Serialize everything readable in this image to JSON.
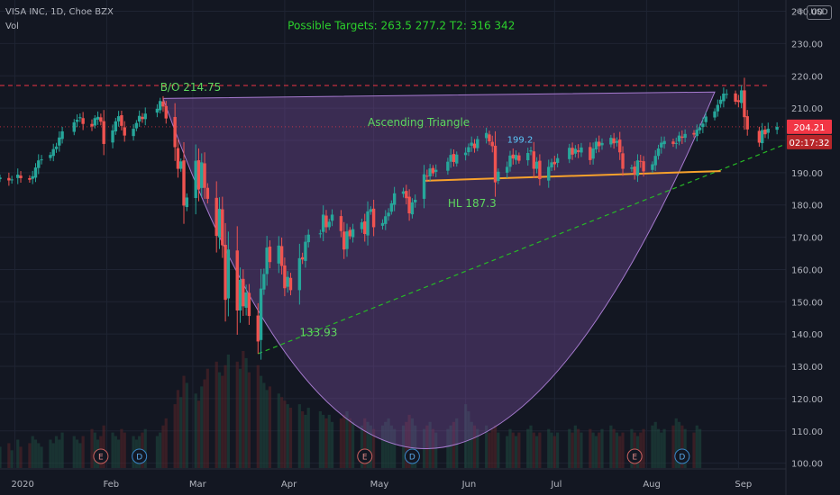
{
  "header": {
    "symbol": "VISA INC, 1D, Choe BZX",
    "indicator": "Vol"
  },
  "currency_label": "USD",
  "colors": {
    "background": "#131722",
    "up": "#26a69a",
    "down": "#ef5350",
    "cup": "#7b4fa0",
    "target_text": "#2cd12c",
    "annot_green": "#5fd75f",
    "hl_line": "#f7a12c",
    "resistance": "#f23645",
    "trend": "#26b826",
    "price_tag": "#f23645",
    "text": "#b2b5be"
  },
  "chart_data": {
    "type": "candlestick",
    "title": "",
    "ylim": [
      98.5,
      243.5
    ],
    "y_ticks": [
      100,
      110,
      120,
      130,
      140,
      150,
      160,
      170,
      180,
      190,
      200,
      210,
      220,
      230,
      240
    ],
    "y_tick_labels": [
      "100.00",
      "110.00",
      "120.00",
      "130.00",
      "140.00",
      "150.00",
      "160.00",
      "170.00",
      "180.00",
      "190.00",
      "200.00",
      "210.00",
      "220.00",
      "230.00",
      "240.00"
    ],
    "x_range": [
      "2019-12-27",
      "2020-09-17"
    ],
    "x_ticks": [
      {
        "date": "2020-01-01",
        "label": "2020"
      },
      {
        "date": "2020-02-01",
        "label": "Feb"
      },
      {
        "date": "2020-03-01",
        "label": "Mar"
      },
      {
        "date": "2020-04-01",
        "label": "Apr"
      },
      {
        "date": "2020-05-01",
        "label": "May"
      },
      {
        "date": "2020-06-01",
        "label": "Jun"
      },
      {
        "date": "2020-07-01",
        "label": "Jul"
      },
      {
        "date": "2020-08-01",
        "label": "Aug"
      },
      {
        "date": "2020-09-01",
        "label": "Sep"
      }
    ],
    "last_price": 204.21,
    "last_price_label": "204.21",
    "countdown": "02:17:32",
    "closes": [
      [
        "2019-12-27",
        188.5
      ],
      [
        "2019-12-30",
        187.6
      ],
      [
        "2019-12-31",
        187.9
      ],
      [
        "2020-01-02",
        189.4
      ],
      [
        "2020-01-03",
        188.3
      ],
      [
        "2020-01-06",
        187.8
      ],
      [
        "2020-01-07",
        188.9
      ],
      [
        "2020-01-08",
        191.6
      ],
      [
        "2020-01-09",
        193.8
      ],
      [
        "2020-01-10",
        194.1
      ],
      [
        "2020-01-13",
        195.5
      ],
      [
        "2020-01-14",
        197.3
      ],
      [
        "2020-01-15",
        198.1
      ],
      [
        "2020-01-16",
        200.9
      ],
      [
        "2020-01-17",
        202.8
      ],
      [
        "2020-01-21",
        205.6
      ],
      [
        "2020-01-22",
        206.4
      ],
      [
        "2020-01-23",
        207.2
      ],
      [
        "2020-01-24",
        205.1
      ],
      [
        "2020-01-27",
        204.3
      ],
      [
        "2020-01-28",
        206.9
      ],
      [
        "2020-01-29",
        207.3
      ],
      [
        "2020-01-30",
        205.8
      ],
      [
        "2020-01-31",
        198.9
      ],
      [
        "2020-02-03",
        203.1
      ],
      [
        "2020-02-04",
        205.9
      ],
      [
        "2020-02-05",
        207.5
      ],
      [
        "2020-02-06",
        204.5
      ],
      [
        "2020-02-07",
        201.5
      ],
      [
        "2020-02-10",
        203.6
      ],
      [
        "2020-02-11",
        205.4
      ],
      [
        "2020-02-12",
        207.6
      ],
      [
        "2020-02-13",
        206.6
      ],
      [
        "2020-02-14",
        208.3
      ],
      [
        "2020-02-18",
        209.8
      ],
      [
        "2020-02-19",
        212.2
      ],
      [
        "2020-02-20",
        210.5
      ],
      [
        "2020-02-21",
        206.8
      ],
      [
        "2020-02-24",
        197.9
      ],
      [
        "2020-02-25",
        191.2
      ],
      [
        "2020-02-26",
        193.5
      ],
      [
        "2020-02-27",
        179.8
      ],
      [
        "2020-02-28",
        182.3
      ],
      [
        "2020-03-02",
        193.7
      ],
      [
        "2020-03-03",
        184.8
      ],
      [
        "2020-03-04",
        193.2
      ],
      [
        "2020-03-05",
        185.3
      ],
      [
        "2020-03-06",
        181.9
      ],
      [
        "2020-03-09",
        170.4
      ],
      [
        "2020-03-10",
        178.8
      ],
      [
        "2020-03-11",
        167.5
      ],
      [
        "2020-03-12",
        150.6
      ],
      [
        "2020-03-13",
        166.2
      ],
      [
        "2020-03-16",
        147.3
      ],
      [
        "2020-03-17",
        156.8
      ],
      [
        "2020-03-18",
        148.6
      ],
      [
        "2020-03-19",
        152.9
      ],
      [
        "2020-03-20",
        145.6
      ],
      [
        "2020-03-23",
        137.7
      ],
      [
        "2020-03-24",
        154.1
      ],
      [
        "2020-03-25",
        158.6
      ],
      [
        "2020-03-26",
        166.8
      ],
      [
        "2020-03-27",
        162.3
      ],
      [
        "2020-03-30",
        167.4
      ],
      [
        "2020-03-31",
        161.1
      ],
      [
        "2020-04-01",
        154.2
      ],
      [
        "2020-04-02",
        157.7
      ],
      [
        "2020-04-03",
        153.6
      ],
      [
        "2020-04-06",
        163.5
      ],
      [
        "2020-04-07",
        163.1
      ],
      [
        "2020-04-08",
        168.6
      ],
      [
        "2020-04-09",
        170.8
      ],
      [
        "2020-04-13",
        171.2
      ],
      [
        "2020-04-14",
        177.0
      ],
      [
        "2020-04-15",
        173.1
      ],
      [
        "2020-04-16",
        174.8
      ],
      [
        "2020-04-17",
        177.0
      ],
      [
        "2020-04-20",
        171.9
      ],
      [
        "2020-04-21",
        166.2
      ],
      [
        "2020-04-22",
        171.8
      ],
      [
        "2020-04-23",
        170.3
      ],
      [
        "2020-04-24",
        172.5
      ],
      [
        "2020-04-27",
        174.6
      ],
      [
        "2020-04-28",
        171.0
      ],
      [
        "2020-04-29",
        178.0
      ],
      [
        "2020-04-30",
        178.7
      ],
      [
        "2020-05-01",
        173.1
      ],
      [
        "2020-05-04",
        174.4
      ],
      [
        "2020-05-05",
        176.5
      ],
      [
        "2020-05-06",
        177.6
      ],
      [
        "2020-05-07",
        180.5
      ],
      [
        "2020-05-08",
        183.6
      ],
      [
        "2020-05-11",
        184.2
      ],
      [
        "2020-05-12",
        182.1
      ],
      [
        "2020-05-13",
        177.4
      ],
      [
        "2020-05-14",
        180.8
      ],
      [
        "2020-05-15",
        181.6
      ],
      [
        "2020-05-18",
        189.5
      ],
      [
        "2020-05-19",
        189.0
      ],
      [
        "2020-05-20",
        191.3
      ],
      [
        "2020-05-21",
        189.8
      ],
      [
        "2020-05-22",
        190.9
      ],
      [
        "2020-05-26",
        193.4
      ],
      [
        "2020-05-27",
        195.5
      ],
      [
        "2020-05-28",
        193.3
      ],
      [
        "2020-05-29",
        195.6
      ],
      [
        "2020-06-01",
        196.2
      ],
      [
        "2020-06-02",
        197.9
      ],
      [
        "2020-06-03",
        199.3
      ],
      [
        "2020-06-04",
        197.6
      ],
      [
        "2020-06-05",
        200.4
      ],
      [
        "2020-06-08",
        202.3
      ],
      [
        "2020-06-09",
        199.7
      ],
      [
        "2020-06-10",
        198.2
      ],
      [
        "2020-06-11",
        187.0
      ],
      [
        "2020-06-12",
        190.3
      ],
      [
        "2020-06-15",
        191.8
      ],
      [
        "2020-06-16",
        195.3
      ],
      [
        "2020-06-17",
        194.4
      ],
      [
        "2020-06-18",
        195.5
      ],
      [
        "2020-06-19",
        193.7
      ],
      [
        "2020-06-22",
        196.1
      ],
      [
        "2020-06-23",
        196.9
      ],
      [
        "2020-06-24",
        191.2
      ],
      [
        "2020-06-25",
        193.4
      ],
      [
        "2020-06-26",
        188.0
      ],
      [
        "2020-06-29",
        191.8
      ],
      [
        "2020-06-30",
        193.2
      ],
      [
        "2020-07-01",
        192.6
      ],
      [
        "2020-07-02",
        194.5
      ],
      [
        "2020-07-06",
        197.7
      ],
      [
        "2020-07-07",
        195.6
      ],
      [
        "2020-07-08",
        197.4
      ],
      [
        "2020-07-09",
        196.4
      ],
      [
        "2020-07-10",
        197.8
      ],
      [
        "2020-07-13",
        193.9
      ],
      [
        "2020-07-14",
        197.5
      ],
      [
        "2020-07-15",
        199.6
      ],
      [
        "2020-07-16",
        198.2
      ],
      [
        "2020-07-17",
        199.2
      ],
      [
        "2020-07-20",
        200.8
      ],
      [
        "2020-07-21",
        199.1
      ],
      [
        "2020-07-22",
        199.8
      ],
      [
        "2020-07-23",
        196.3
      ],
      [
        "2020-07-24",
        191.2
      ],
      [
        "2020-07-27",
        191.6
      ],
      [
        "2020-07-28",
        189.5
      ],
      [
        "2020-07-29",
        193.8
      ],
      [
        "2020-07-30",
        193.4
      ],
      [
        "2020-07-31",
        190.4
      ],
      [
        "2020-08-03",
        192.6
      ],
      [
        "2020-08-04",
        195.2
      ],
      [
        "2020-08-05",
        197.5
      ],
      [
        "2020-08-06",
        199.3
      ],
      [
        "2020-08-07",
        199.8
      ],
      [
        "2020-08-10",
        198.9
      ],
      [
        "2020-08-11",
        199.2
      ],
      [
        "2020-08-12",
        201.5
      ],
      [
        "2020-08-13",
        200.8
      ],
      [
        "2020-08-14",
        202.0
      ],
      [
        "2020-08-17",
        201.8
      ],
      [
        "2020-08-18",
        203.3
      ],
      [
        "2020-08-19",
        204.0
      ],
      [
        "2020-08-20",
        205.2
      ],
      [
        "2020-08-21",
        207.4
      ],
      [
        "2020-08-24",
        209.0
      ],
      [
        "2020-08-25",
        211.0
      ],
      [
        "2020-08-26",
        212.6
      ],
      [
        "2020-08-27",
        214.5
      ],
      [
        "2020-08-28",
        214.4
      ],
      [
        "2020-08-31",
        212.0
      ],
      [
        "2020-09-01",
        211.9
      ],
      [
        "2020-09-02",
        215.5
      ],
      [
        "2020-09-03",
        207.2
      ],
      [
        "2020-09-04",
        203.4
      ],
      [
        "2020-09-08",
        199.3
      ],
      [
        "2020-09-09",
        203.2
      ],
      [
        "2020-09-10",
        201.9
      ],
      [
        "2020-09-11",
        203.6
      ],
      [
        "2020-09-14",
        204.2
      ]
    ],
    "volume": {
      "values": [
        6,
        7,
        5,
        8,
        6,
        7,
        9,
        8,
        7,
        6,
        8,
        7,
        9,
        8,
        10,
        9,
        8,
        7,
        9,
        11,
        10,
        8,
        9,
        12,
        10,
        9,
        8,
        11,
        10,
        9,
        8,
        9,
        10,
        11,
        9,
        10,
        12,
        14,
        18,
        22,
        20,
        26,
        24,
        21,
        19,
        23,
        25,
        28,
        30,
        27,
        26,
        29,
        32,
        30,
        28,
        33,
        31,
        27,
        29,
        26,
        24,
        22,
        23,
        21,
        20,
        19,
        18,
        17,
        18,
        16,
        15,
        17,
        16,
        15,
        14,
        15,
        13,
        14,
        15,
        16,
        14,
        13,
        12,
        14,
        13,
        12,
        11,
        12,
        13,
        14,
        12,
        11,
        12,
        13,
        15,
        14,
        12,
        11,
        12,
        13,
        11,
        10,
        11,
        12,
        13,
        14,
        18,
        16,
        13,
        12,
        11,
        12,
        10,
        11,
        12,
        10,
        9,
        11,
        10,
        9,
        10,
        11,
        12,
        10,
        9,
        10,
        11,
        10,
        9,
        10,
        11,
        10,
        12,
        11,
        10,
        11,
        10,
        9,
        10,
        11,
        12,
        11,
        10,
        9,
        10,
        11,
        10,
        9,
        10,
        11,
        12,
        13,
        11,
        10,
        11,
        12,
        14,
        13,
        12,
        11,
        10,
        12,
        11
      ],
      "max": 33
    },
    "earnings_markers": [
      {
        "date": "2020-01-30",
        "label": "E"
      },
      {
        "date": "2020-04-28",
        "label": "E"
      },
      {
        "date": "2020-07-28",
        "label": "E"
      }
    ],
    "dividend_markers": [
      {
        "date": "2020-02-12",
        "label": "D"
      },
      {
        "date": "2020-05-14",
        "label": "D"
      },
      {
        "date": "2020-08-13",
        "label": "D"
      }
    ],
    "drawings": {
      "resistance": {
        "y": 217.0,
        "x": [
          "2019-12-27",
          "2020-09-11"
        ]
      },
      "trendline": {
        "from": [
          "2020-03-23",
          133.9
        ],
        "to": [
          "2020-09-17",
          198.9
        ]
      },
      "hl_line": {
        "from": [
          "2020-05-18",
          187.5
        ],
        "to": [
          "2020-08-26",
          190.5
        ]
      },
      "cup": {
        "left": [
          "2020-02-20",
          213.0
        ],
        "bottom": [
          "2020-05-19",
          104.5
        ],
        "right": [
          "2020-08-24",
          215.0
        ]
      },
      "price_dotted": 204.21
    },
    "annotations": [
      {
        "text": "Possible Targets:  263.5    277.2    T2:  316   342",
        "date": "2020-04-02",
        "y": 234.5,
        "color": "target"
      },
      {
        "text": "B/O 214.75",
        "date": "2020-02-19",
        "y": 215.3,
        "color": "green"
      },
      {
        "text": "Ascending Triangle",
        "date": "2020-04-29",
        "y": 204.5,
        "color": "green"
      },
      {
        "text": "199.2",
        "date": "2020-06-15",
        "y": 199.3,
        "color": "cyan"
      },
      {
        "text": "HL  187.3",
        "date": "2020-05-26",
        "y": 179.3,
        "color": "green"
      },
      {
        "text": "133.93",
        "date": "2020-04-06",
        "y": 139.3,
        "color": "green"
      }
    ]
  }
}
